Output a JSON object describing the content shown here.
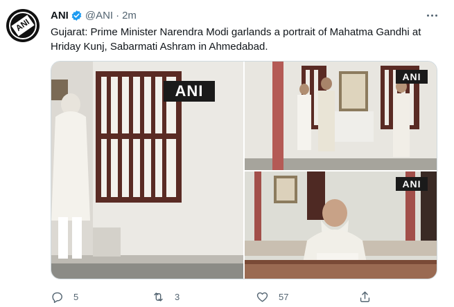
{
  "tweet": {
    "display_name": "ANI",
    "handle": "@ANI",
    "separator": "·",
    "time": "2m",
    "avatar_label": "ANI",
    "text": "Gujarat: Prime Minister Narendra Modi garlands a portrait of Mahatma Gandhi at Hriday Kunj, Sabarmati Ashram in Ahmedabad."
  },
  "media": {
    "watermark": "ANI",
    "images": [
      {
        "icon": "photo-leader-garlanding-portrait"
      },
      {
        "icon": "photo-leaders-standing-before-portrait"
      },
      {
        "icon": "photo-leader-signing-visitor-book"
      }
    ]
  },
  "actions": {
    "reply_count": "5",
    "retweet_count": "3",
    "like_count": "57"
  },
  "colors": {
    "text": "#0f1419",
    "secondary": "#536471",
    "verified": "#1d9bf0",
    "border": "#cfd9de"
  }
}
